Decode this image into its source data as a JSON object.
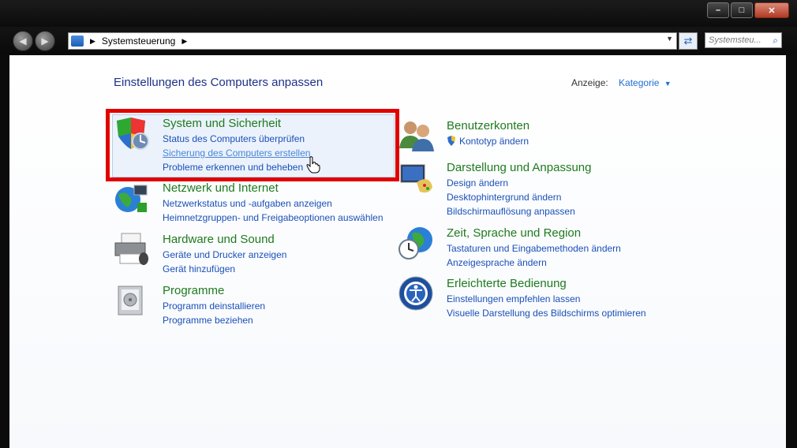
{
  "window": {
    "buttons": {
      "minimize": "–",
      "maximize": "□",
      "close": "✕"
    }
  },
  "navbar": {
    "back": "◀",
    "forward": "▶",
    "address": {
      "separator": "▶",
      "crumb": "Systemsteuerung",
      "crumb_separator": "▶",
      "dropdown": "▼"
    },
    "refresh": "⇄",
    "search_placeholder": "Systemsteu...",
    "search_icon": "⌕"
  },
  "header": {
    "title": "Einstellungen des Computers anpassen",
    "view_label": "Anzeige:",
    "view_value": "Kategorie",
    "view_arrow": "▼"
  },
  "categories": [
    {
      "icon": "shield-icon",
      "title": "System und Sicherheit",
      "links": [
        "Status des Computers überprüfen",
        "Sicherung des Computers erstellen",
        "Probleme erkennen und beheben"
      ]
    },
    {
      "icon": "network-globe-icon",
      "title": "Netzwerk und Internet",
      "links": [
        "Netzwerkstatus und -aufgaben anzeigen",
        "Heimnetzgruppen- und Freigabeoptionen auswählen"
      ]
    },
    {
      "icon": "printer-icon",
      "title": "Hardware und Sound",
      "links": [
        "Geräte und Drucker anzeigen",
        "Gerät hinzufügen"
      ]
    },
    {
      "icon": "programs-icon",
      "title": "Programme",
      "links": [
        "Programm deinstallieren",
        "Programme beziehen"
      ]
    },
    {
      "icon": "users-icon",
      "title": "Benutzerkonten",
      "links": [
        "Kontotyp ändern"
      ]
    },
    {
      "icon": "display-palette-icon",
      "title": "Darstellung und Anpassung",
      "links": [
        "Design ändern",
        "Desktophintergrund ändern",
        "Bildschirmauflösung anpassen"
      ]
    },
    {
      "icon": "clock-globe-icon",
      "title": "Zeit, Sprache und Region",
      "links": [
        "Tastaturen und Eingabemethoden ändern",
        "Anzeigesprache ändern"
      ]
    },
    {
      "icon": "ease-of-access-icon",
      "title": "Erleichterte Bedienung",
      "links": [
        "Einstellungen empfehlen lassen",
        "Visuelle Darstellung des Bildschirms optimieren"
      ]
    }
  ],
  "colors": {
    "heading": "#1e7b1e",
    "link": "#1a50b8",
    "highlight_border": "#e10000",
    "title": "#1e3287"
  }
}
